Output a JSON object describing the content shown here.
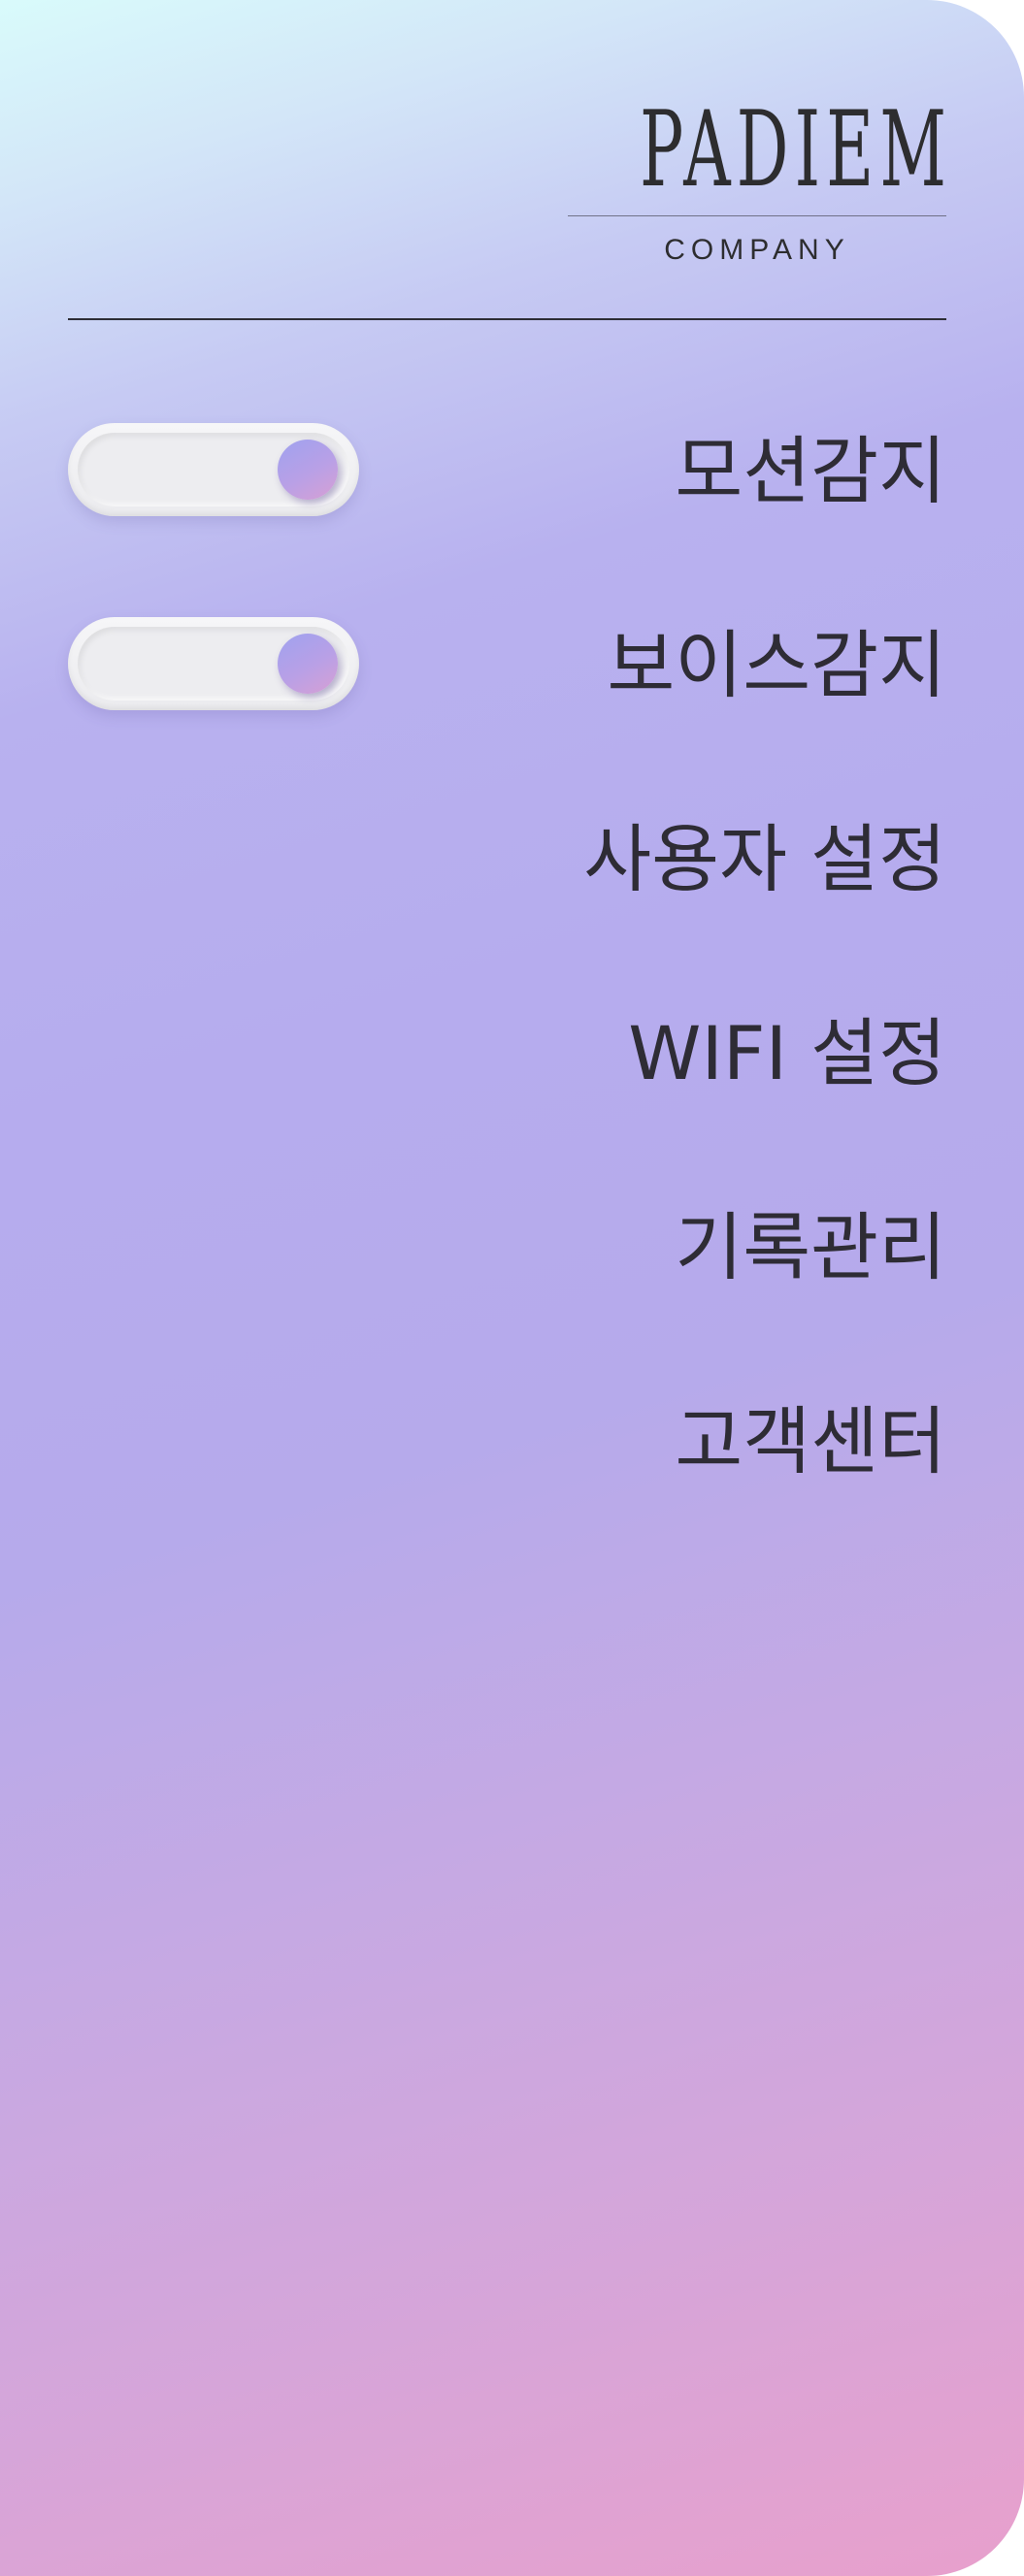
{
  "brand": {
    "name": "PADIEM",
    "subtitle": "COMPANY"
  },
  "menu": {
    "items": [
      {
        "label": "모션감지",
        "toggle": true,
        "toggle_state": "on"
      },
      {
        "label": "보이스감지",
        "toggle": true,
        "toggle_state": "on"
      },
      {
        "label": "사용자 설정",
        "toggle": false
      },
      {
        "label": "WIFI 설정",
        "toggle": false
      },
      {
        "label": "기록관리",
        "toggle": false
      },
      {
        "label": "고객센터",
        "toggle": false
      }
    ]
  },
  "colors": {
    "gradient_top": "#d9fbfb",
    "gradient_mid": "#b6acee",
    "gradient_bottom": "#e8a0cc",
    "text": "#2e2c35",
    "toggle_knob": "#b0a0e8"
  }
}
